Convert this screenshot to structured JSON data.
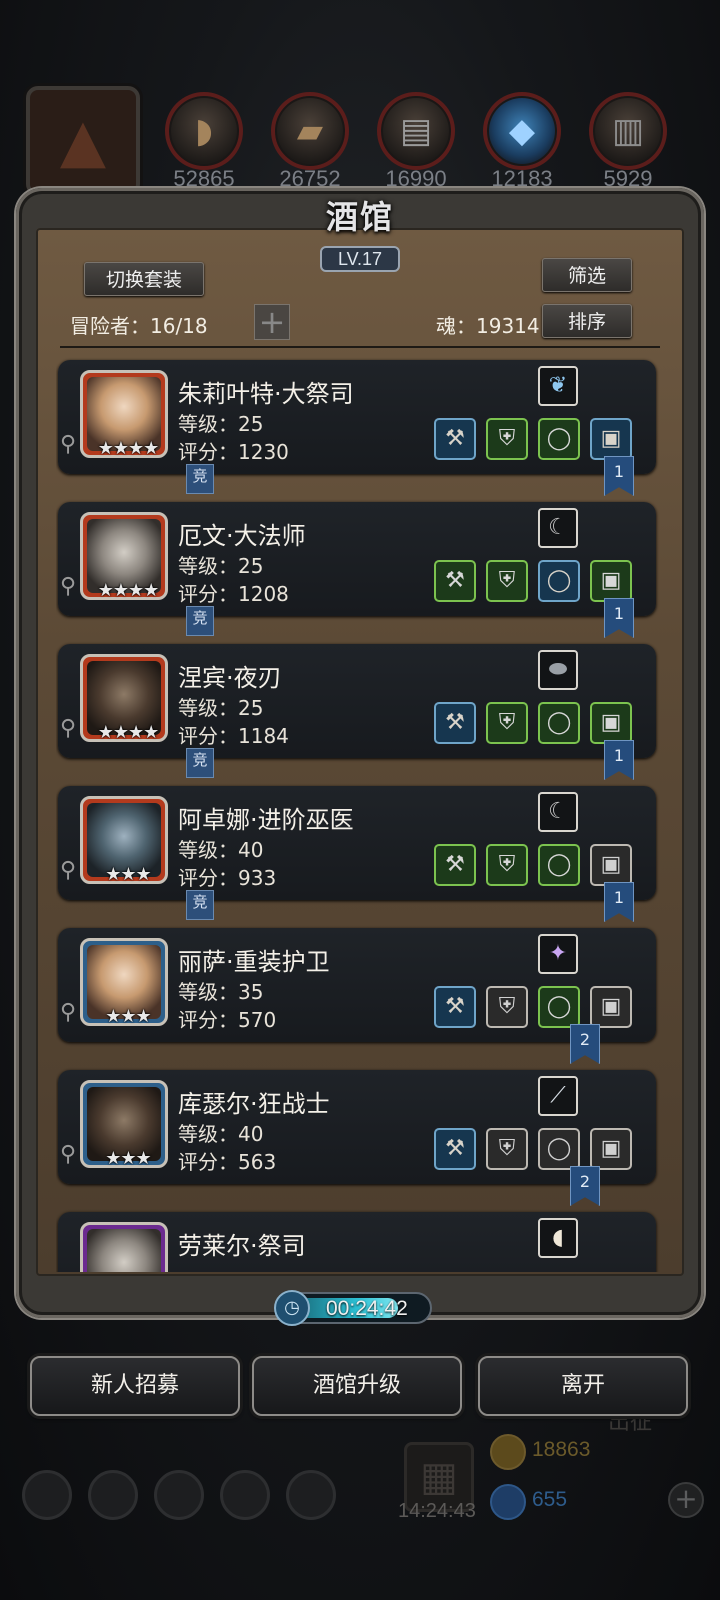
{
  "resources": [
    {
      "name": "meat-icon",
      "value": "52865"
    },
    {
      "name": "wood-icon",
      "value": "26752"
    },
    {
      "name": "iron-icon",
      "value": "16990"
    },
    {
      "name": "crystal-icon",
      "value": "12183"
    },
    {
      "name": "stone-icon",
      "value": "5929"
    }
  ],
  "panel": {
    "title": "酒馆",
    "level": "LV.17",
    "switch_outfit": "切换套装",
    "filter": "筛选",
    "sort": "排序",
    "adventurers_label": "冒险者：16/18",
    "soul_label": "魂：19314",
    "plus": "+"
  },
  "heroes": [
    {
      "name": "朱莉叶特·大祭司",
      "level": "等级：25",
      "score": "评分：1230",
      "stars": "★★★★",
      "tag": "竞",
      "ribbon": "1",
      "frame": "red",
      "skill": "wing",
      "equip": [
        "blue",
        "green",
        "green",
        "blue"
      ]
    },
    {
      "name": "厄文·大法师",
      "level": "等级：25",
      "score": "评分：1208",
      "stars": "★★★★",
      "tag": "竞",
      "ribbon": "1",
      "frame": "red",
      "skill": "claw",
      "equip": [
        "green",
        "green",
        "blue",
        "green"
      ]
    },
    {
      "name": "涅宾·夜刃",
      "level": "等级：25",
      "score": "评分：1184",
      "stars": "★★★★",
      "tag": "竞",
      "ribbon": "1",
      "frame": "red",
      "skill": "stone",
      "equip": [
        "blue",
        "green",
        "green",
        "green"
      ]
    },
    {
      "name": "阿卓娜·进阶巫医",
      "level": "等级：40",
      "score": "评分：933",
      "stars": "★★★",
      "tag": "竞",
      "ribbon": "1",
      "frame": "red",
      "skill": "claw",
      "equip": [
        "green",
        "green",
        "green",
        "grey"
      ]
    },
    {
      "name": "丽萨·重装护卫",
      "level": "等级：35",
      "score": "评分：570",
      "stars": "★★★",
      "tag": "",
      "ribbon": "2",
      "frame": "blue",
      "skill": "gem",
      "equip": [
        "blue",
        "grey",
        "green",
        "grey"
      ]
    },
    {
      "name": "库瑟尔·狂战士",
      "level": "等级：40",
      "score": "评分：563",
      "stars": "★★★",
      "tag": "",
      "ribbon": "2",
      "frame": "blue",
      "skill": "blade",
      "equip": [
        "blue",
        "grey",
        "grey",
        "grey"
      ]
    },
    {
      "name": "劳莱尔·祭司",
      "level": "",
      "score": "",
      "stars": "",
      "tag": "",
      "ribbon": "",
      "frame": "purple",
      "skill": "horn",
      "equip": []
    }
  ],
  "timer": "00:24:42",
  "actions": {
    "recruit": "新人招募",
    "upgrade": "酒馆升级",
    "leave": "离开"
  },
  "hud": {
    "gift_time": "14:24:43",
    "gold": "18863",
    "gems": "655",
    "expedition": "出征"
  }
}
